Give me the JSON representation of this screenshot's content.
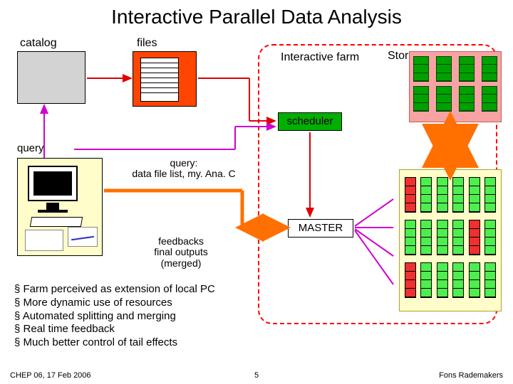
{
  "title": "Interactive Parallel Data Analysis",
  "labels": {
    "catalog": "catalog",
    "files": "files",
    "farm": "Interactive farm",
    "storage": "Storage",
    "scheduler": "scheduler",
    "master": "MASTER",
    "query": "query",
    "query_detail": "query:\ndata file list, my. Ana. C",
    "feedbacks": "feedbacks\nfinal outputs\n(merged)"
  },
  "bullets": [
    "Farm perceived as extension of local PC",
    "More dynamic use of resources",
    "Automated splitting and merging",
    "Real time feedback",
    "Much better control of tail effects"
  ],
  "footer": {
    "left": "CHEP 06, 17 Feb 2006",
    "center": "5",
    "right": "Fons Rademakers"
  }
}
